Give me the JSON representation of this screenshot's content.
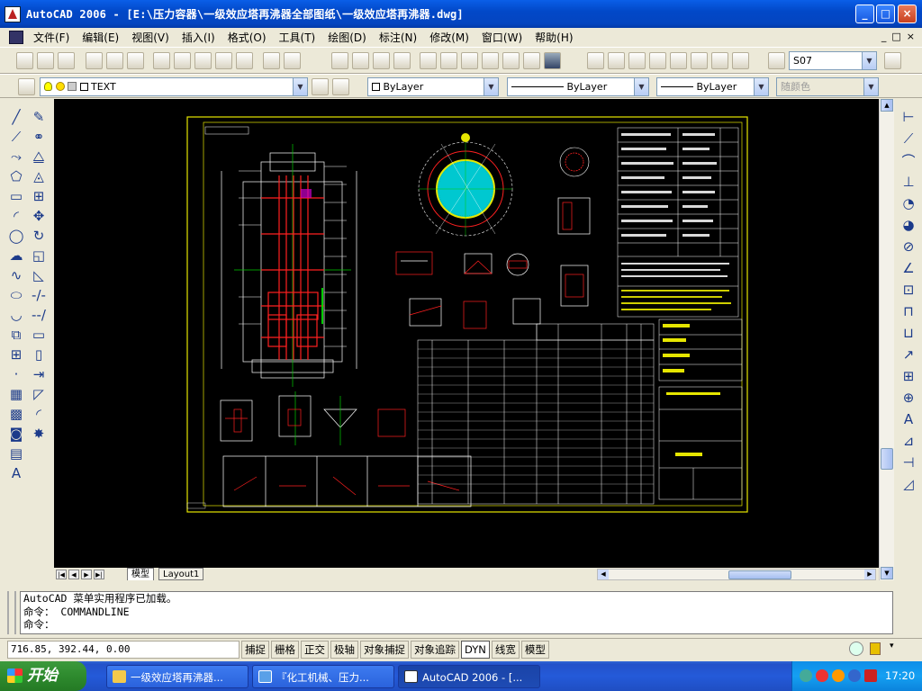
{
  "window": {
    "title": "AutoCAD 2006 - [E:\\压力容器\\一级效应塔再沸器全部图纸\\一级效应塔再沸器.dwg]",
    "minimize": "_",
    "maximize": "□",
    "close": "×"
  },
  "menu": [
    {
      "label": "文件(F)"
    },
    {
      "label": "编辑(E)"
    },
    {
      "label": "视图(V)"
    },
    {
      "label": "插入(I)"
    },
    {
      "label": "格式(O)"
    },
    {
      "label": "工具(T)"
    },
    {
      "label": "绘图(D)"
    },
    {
      "label": "标注(N)"
    },
    {
      "label": "修改(M)"
    },
    {
      "label": "窗口(W)"
    },
    {
      "label": "帮助(H)"
    }
  ],
  "mdi_buttons": {
    "min": "_",
    "restore": "□",
    "close": "×"
  },
  "toolbar": {
    "textstyle": "S07",
    "layer": "TEXT",
    "color": "ByLayer",
    "linetype": "ByLayer",
    "lineweight": "ByLayer",
    "plotstyle": "随颜色"
  },
  "layout_tabs": {
    "model": "模型",
    "layout1": "Layout1"
  },
  "command": {
    "lines": [
      "AutoCAD 菜单实用程序已加载。",
      "命令： COMMANDLINE",
      "命令："
    ]
  },
  "status": {
    "coordinates": "716.85, 392.44, 0.00",
    "buttons": [
      {
        "label": "捕捉",
        "on": false
      },
      {
        "label": "栅格",
        "on": false
      },
      {
        "label": "正交",
        "on": false
      },
      {
        "label": "极轴",
        "on": false
      },
      {
        "label": "对象捕捉",
        "on": false
      },
      {
        "label": "对象追踪",
        "on": false
      },
      {
        "label": "DYN",
        "on": true
      },
      {
        "label": "线宽",
        "on": false
      },
      {
        "label": "模型",
        "on": false
      }
    ]
  },
  "taskbar": {
    "start": "开始",
    "tasks": [
      {
        "label": "一级效应塔再沸器..."
      },
      {
        "label": "『化工机械、压力..."
      },
      {
        "label": "AutoCAD 2006 - [..."
      }
    ],
    "clock": "17:20"
  },
  "colors": {
    "drawing_background": "#000000",
    "frame": "#e6e600",
    "geometry": "#ffffff",
    "red": "#ff2020",
    "cyan": "#00e0e0"
  }
}
